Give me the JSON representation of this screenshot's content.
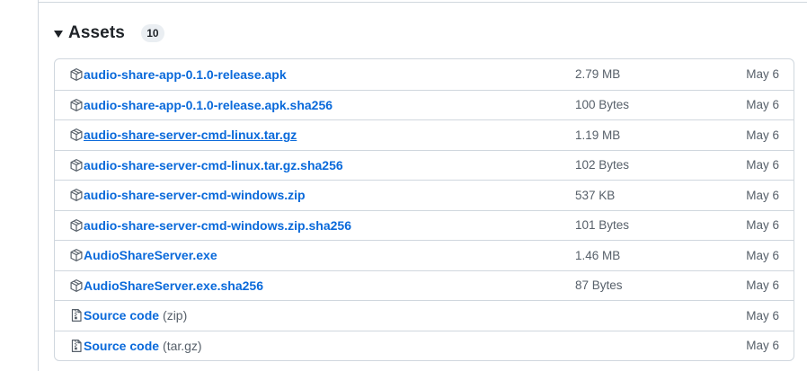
{
  "assets": {
    "title": "Assets",
    "count": "10",
    "items": [
      {
        "name": "audio-share-app-0.1.0-release.apk",
        "suffix": "",
        "size": "2.79 MB",
        "date": "May 6",
        "icon": "package-icon",
        "hovered": false
      },
      {
        "name": "audio-share-app-0.1.0-release.apk.sha256",
        "suffix": "",
        "size": "100 Bytes",
        "date": "May 6",
        "icon": "package-icon",
        "hovered": false
      },
      {
        "name": "audio-share-server-cmd-linux.tar.gz",
        "suffix": "",
        "size": "1.19 MB",
        "date": "May 6",
        "icon": "package-icon",
        "hovered": true
      },
      {
        "name": "audio-share-server-cmd-linux.tar.gz.sha256",
        "suffix": "",
        "size": "102 Bytes",
        "date": "May 6",
        "icon": "package-icon",
        "hovered": false
      },
      {
        "name": "audio-share-server-cmd-windows.zip",
        "suffix": "",
        "size": "537 KB",
        "date": "May 6",
        "icon": "package-icon",
        "hovered": false
      },
      {
        "name": "audio-share-server-cmd-windows.zip.sha256",
        "suffix": "",
        "size": "101 Bytes",
        "date": "May 6",
        "icon": "package-icon",
        "hovered": false
      },
      {
        "name": "AudioShareServer.exe",
        "suffix": "",
        "size": "1.46 MB",
        "date": "May 6",
        "icon": "package-icon",
        "hovered": false
      },
      {
        "name": "AudioShareServer.exe.sha256",
        "suffix": "",
        "size": "87 Bytes",
        "date": "May 6",
        "icon": "package-icon",
        "hovered": false
      },
      {
        "name": "Source code",
        "suffix": "(zip)",
        "size": "",
        "date": "May 6",
        "icon": "file-zip-icon",
        "hovered": false
      },
      {
        "name": "Source code",
        "suffix": "(tar.gz)",
        "size": "",
        "date": "May 6",
        "icon": "file-zip-icon",
        "hovered": false
      }
    ]
  },
  "colors": {
    "link": "#0969da",
    "muted": "#57606a",
    "border": "#d0d7de",
    "badge_bg": "#eaeef2"
  }
}
